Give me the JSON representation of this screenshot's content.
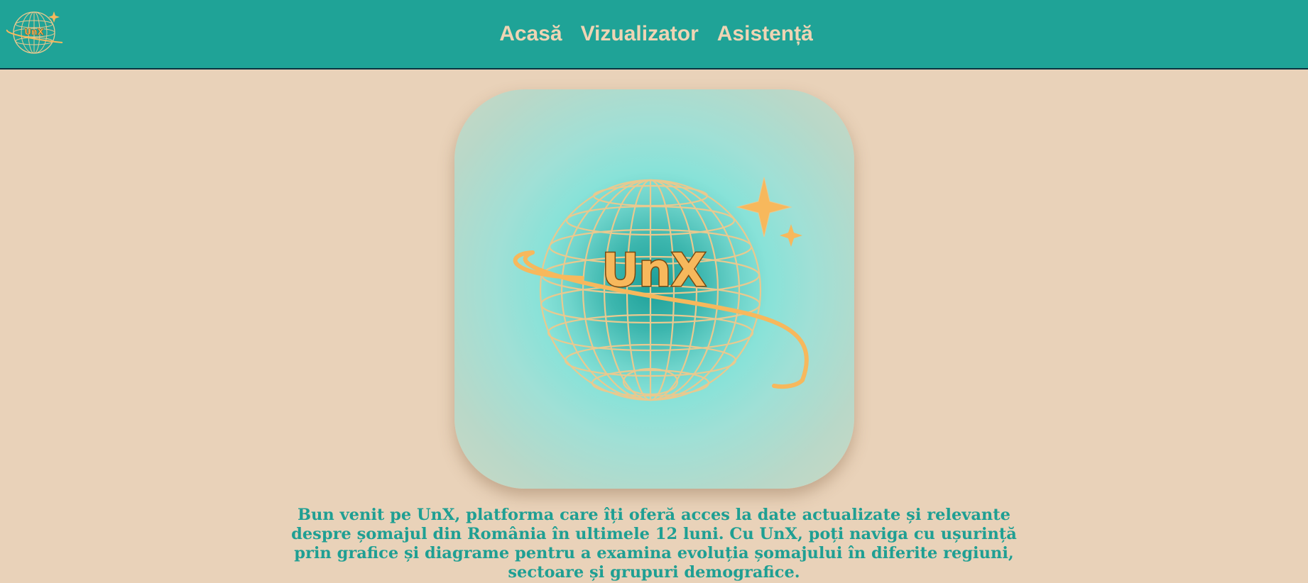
{
  "header": {
    "logo_icon": "unx-globe-logo-icon",
    "logo_text": "UnX",
    "nav": [
      {
        "label": "Acasă"
      },
      {
        "label": "Vizualizator"
      },
      {
        "label": "Asistență"
      }
    ]
  },
  "hero": {
    "logo_icon": "unx-globe-logo-icon",
    "logo_text": "UnX"
  },
  "intro": {
    "text": "Bun venit pe UnX, platforma care îți oferă acces la date actualizate și relevante despre șomajul din România în ultimele 12 luni. Cu UnX, poți naviga cu ușurință prin grafice și diagrame pentru a examina evoluția șomajului în diferite regiuni, sectoare și grupuri demografice."
  },
  "colors": {
    "header_bg": "#1fa397",
    "page_bg": "#e9d2b9",
    "nav_text": "#efd4b4",
    "accent": "#f7b85c",
    "intro_text": "#1f9f93"
  }
}
